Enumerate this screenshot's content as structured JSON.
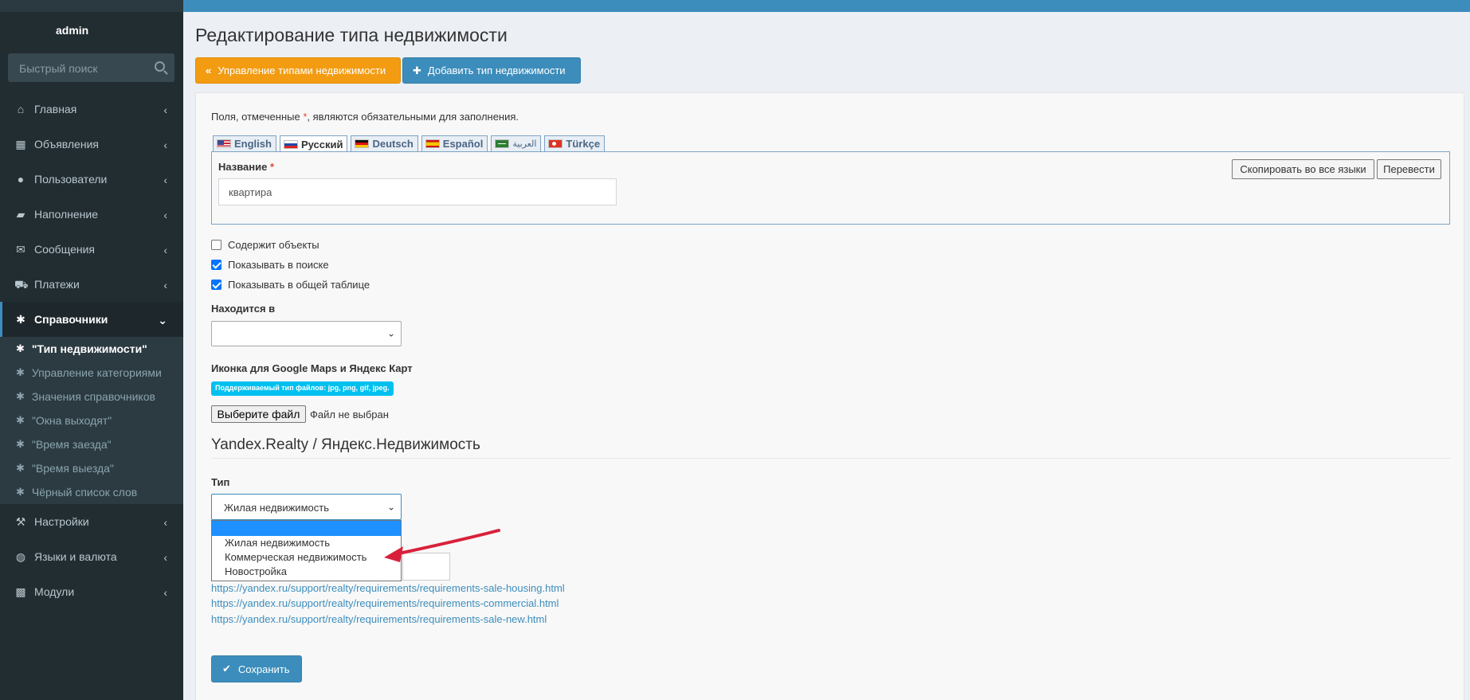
{
  "sidebar": {
    "username": "admin",
    "search_placeholder": "Быстрый поиск",
    "items": [
      {
        "label": "Главная",
        "icon": "home-icon"
      },
      {
        "label": "Объявления",
        "icon": "grid-icon"
      },
      {
        "label": "Пользователи",
        "icon": "user-icon"
      },
      {
        "label": "Наполнение",
        "icon": "folder-icon"
      },
      {
        "label": "Сообщения",
        "icon": "envelope-icon"
      },
      {
        "label": "Платежи",
        "icon": "cart-icon"
      },
      {
        "label": "Справочники",
        "icon": "asterisk-icon"
      }
    ],
    "subitems": [
      {
        "label": "\"Тип недвижимости\""
      },
      {
        "label": "Управление категориями"
      },
      {
        "label": "Значения справочников"
      },
      {
        "label": "\"Окна выходят\""
      },
      {
        "label": "\"Время заезда\""
      },
      {
        "label": "\"Время выезда\""
      },
      {
        "label": "Чёрный список слов"
      }
    ],
    "items_after": [
      {
        "label": "Настройки",
        "icon": "wrench-icon"
      },
      {
        "label": "Языки и валюта",
        "icon": "globe-icon"
      },
      {
        "label": "Модули",
        "icon": "modules-icon"
      }
    ]
  },
  "page": {
    "title": "Редактирование типа недвижимости",
    "btn_manage": "Управление типами недвижимости",
    "btn_add": "Добавить тип недвижимости",
    "required_note_pre": "Поля, отмеченные ",
    "required_star": "*",
    "required_note_post": ", являются обязательными для заполнения."
  },
  "tabs": [
    {
      "label": "English",
      "flag": "us"
    },
    {
      "label": "Русский",
      "flag": "ru"
    },
    {
      "label": "Deutsch",
      "flag": "de"
    },
    {
      "label": "Español",
      "flag": "es"
    },
    {
      "label": "العربية",
      "flag": "ar"
    },
    {
      "label": "Türkçe",
      "flag": "tr"
    }
  ],
  "form": {
    "name_label": "Название",
    "name_star": "*",
    "name_value": "квартира",
    "copy_all_btn": "Скопировать во все языки",
    "translate_btn": "Перевести",
    "cb_contains": "Содержит объекты",
    "cb_search": "Показывать в поиске",
    "cb_table": "Показывать в общей таблице",
    "located_label": "Находится в",
    "located_value": "",
    "icon_label": "Иконка для Google Maps и Яндекс Карт",
    "filetypes_badge": "Поддерживаемый тип файлов: jpg, png, gif, jpeg.",
    "file_button": "Выберите файл",
    "file_none": "Файл не выбран",
    "section_title": "Yandex.Realty / Яндекс.Недвижимость",
    "type_label": "Тип",
    "type_value": "Жилая недвижимость",
    "type_options": [
      "",
      "Жилая недвижимость",
      "Коммерческая недвижимость",
      "Новостройка"
    ],
    "links": [
      "https://yandex.ru/support/realty/requirements/requirements-sale-housing.html",
      "https://yandex.ru/support/realty/requirements/requirements-commercial.html",
      "https://yandex.ru/support/realty/requirements/requirements-sale-new.html"
    ],
    "save_btn": "Сохранить"
  },
  "colors": {
    "topbar": "#3c8dbc",
    "sidebar": "#222d32",
    "warning": "#f39c12",
    "primary": "#3c8dbc",
    "badge": "#00c0ef",
    "annotation_arrow": "#d9203a"
  }
}
